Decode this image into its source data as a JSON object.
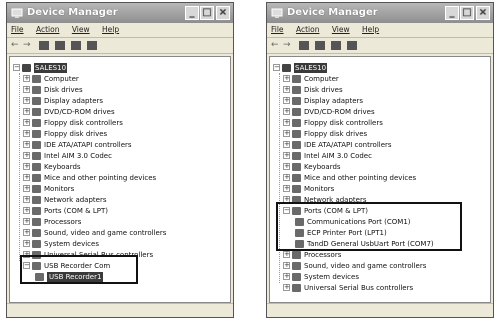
{
  "left": {
    "title": "Device Manager",
    "menu": [
      "File",
      "Action",
      "View",
      "Help"
    ],
    "root": "SALES10",
    "items": [
      "Computer",
      "Disk drives",
      "Display adapters",
      "DVD/CD-ROM drives",
      "Floppy disk controllers",
      "Floppy disk drives",
      "IDE ATA/ATAPI controllers",
      "Intel AIM 3.0 Codec",
      "Keyboards",
      "Mice and other pointing devices",
      "Monitors",
      "Network adapters",
      "Ports (COM & LPT)",
      "Processors",
      "Sound, video and game controllers",
      "System devices",
      "Universal Serial Bus controllers",
      "USB Recorder Com",
      "USB Recorder1"
    ]
  },
  "right": {
    "title": "Device Manager",
    "menu": [
      "File",
      "Action",
      "View",
      "Help"
    ],
    "root": "SALES10",
    "items": [
      "Computer",
      "Disk drives",
      "Display adapters",
      "DVD/CD-ROM drives",
      "Floppy disk controllers",
      "Floppy disk drives",
      "IDE ATA/ATAPI controllers",
      "Intel AIM 3.0 Codec",
      "Keyboards",
      "Mice and other pointing devices",
      "Monitors",
      "Network adapters",
      "Ports (COM & LPT)",
      "Communications Port (COM1)",
      "ECP Printer Port (LPT1)",
      "TandD General UsbUart Port (COM7)",
      "Processors",
      "Sound, video and game controllers",
      "System devices",
      "Universal Serial Bus controllers"
    ]
  }
}
